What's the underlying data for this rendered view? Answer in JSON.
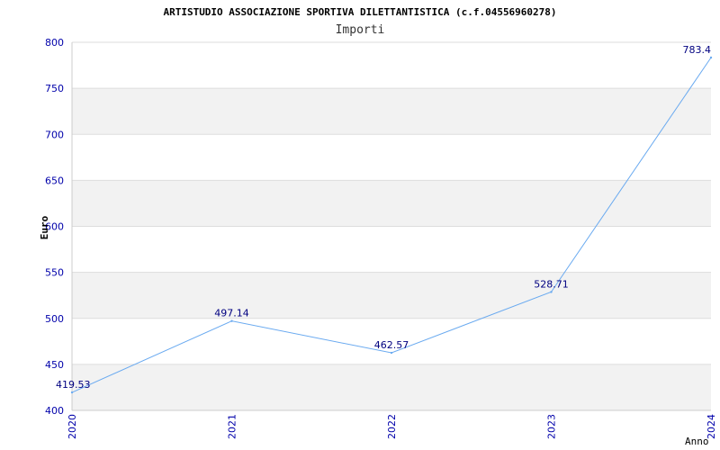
{
  "chart_data": {
    "type": "line",
    "title": "ARTISTUDIO ASSOCIAZIONE SPORTIVA DILETTANTISTICA (c.f.04556960278)",
    "subtitle": "Importi",
    "xlabel": "Anno",
    "ylabel": "Euro",
    "x": [
      "2020",
      "2021",
      "2022",
      "2023",
      "2024"
    ],
    "series": [
      {
        "values": [
          419.53,
          497.14,
          462.57,
          528.71,
          783.4
        ]
      }
    ],
    "data_labels": [
      "419.53",
      "497.14",
      "462.57",
      "528.71",
      "783.4"
    ],
    "ylim": [
      400,
      800
    ],
    "yticks": [
      "400",
      "450",
      "500",
      "550",
      "600",
      "650",
      "700",
      "750",
      "800"
    ],
    "grid": true,
    "colors": {
      "line": "#6aaaf0",
      "band": "#f2f2f2",
      "tick_text": "#0000aa",
      "label_text": "#000080",
      "title_text": "#000000"
    }
  }
}
